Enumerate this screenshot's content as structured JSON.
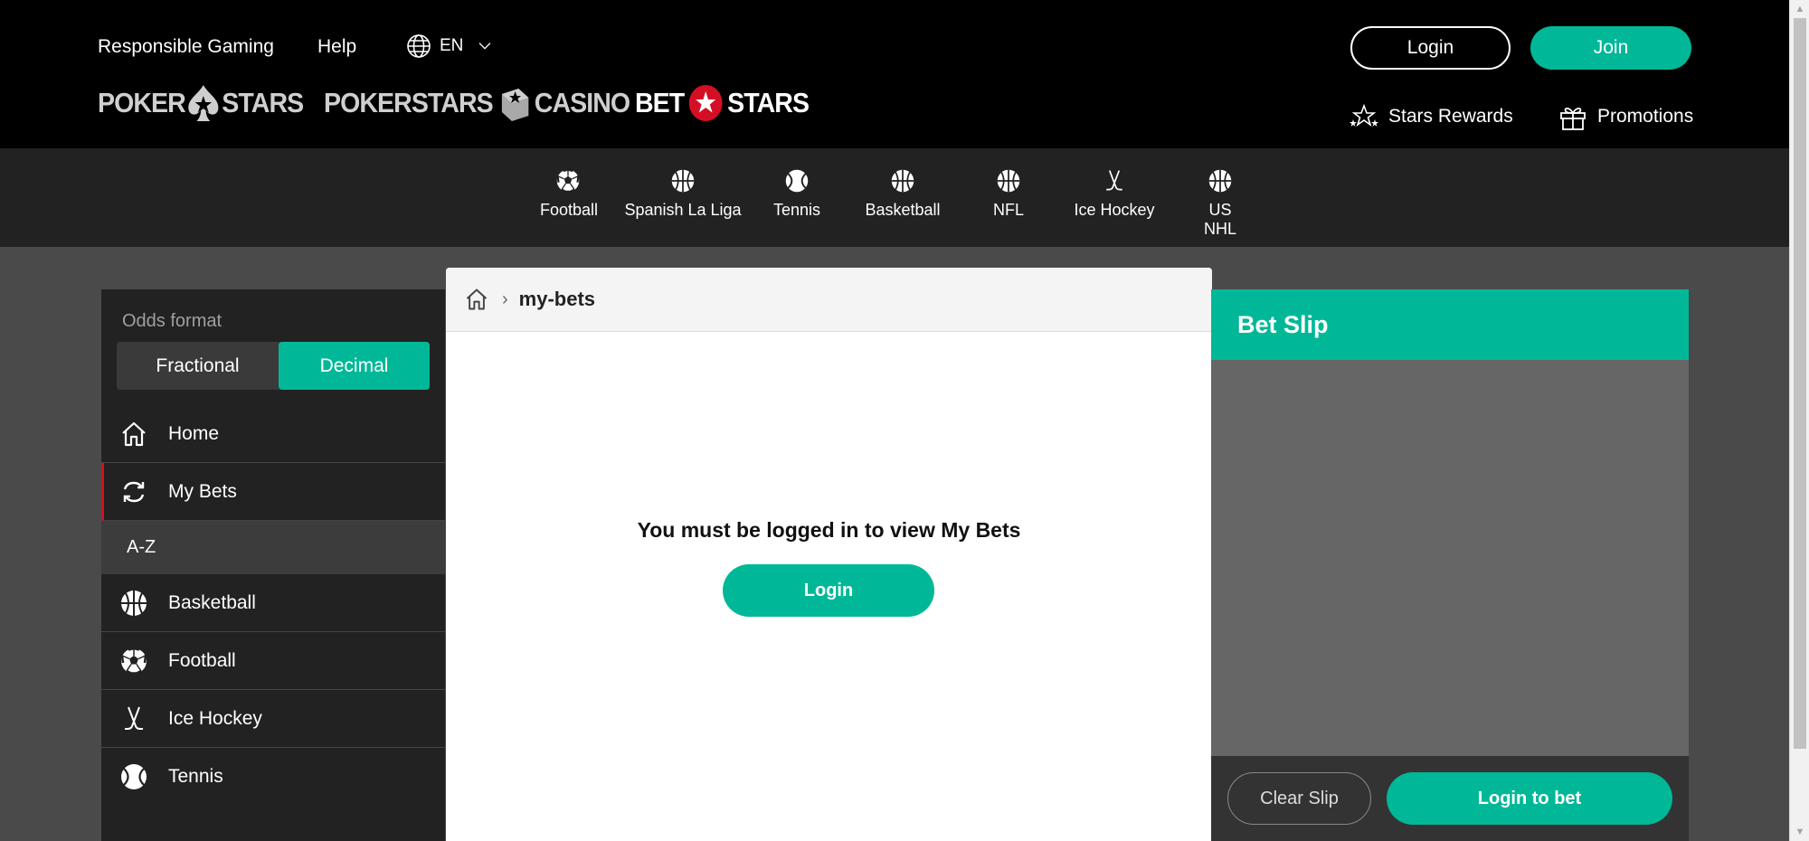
{
  "header": {
    "links": [
      "Responsible Gaming",
      "Help"
    ],
    "language": "EN",
    "login_label": "Login",
    "join_label": "Join",
    "logos": {
      "poker_left": "POKER",
      "poker_right": "STARS",
      "casino_left": "POKERSTARS",
      "casino_right": "CASINO",
      "bet_left": "BET",
      "bet_right": "STARS"
    },
    "stars_rewards": "Stars Rewards",
    "promotions": "Promotions"
  },
  "sports_nav": [
    {
      "label": "Football",
      "icon": "football-icon"
    },
    {
      "label": "Spanish La Liga",
      "icon": "basketball-icon"
    },
    {
      "label": "Tennis",
      "icon": "tennis-icon"
    },
    {
      "label": "Basketball",
      "icon": "basketball-icon"
    },
    {
      "label": "NFL",
      "icon": "basketball-icon"
    },
    {
      "label": "Ice Hockey",
      "icon": "hockey-sticks-icon"
    },
    {
      "label": "US NHL",
      "icon": "basketball-icon"
    }
  ],
  "sidebar": {
    "odds_label": "Odds format",
    "odds_options": [
      "Fractional",
      "Decimal"
    ],
    "odds_selected": "Decimal",
    "menu": [
      {
        "label": "Home",
        "icon": "home-icon"
      },
      {
        "label": "My Bets",
        "icon": "my-bets-icon",
        "active": true
      }
    ],
    "az_label": "A-Z",
    "sports": [
      {
        "label": "Basketball",
        "icon": "basketball-icon"
      },
      {
        "label": "Football",
        "icon": "football-icon"
      },
      {
        "label": "Ice Hockey",
        "icon": "hockey-sticks-icon"
      },
      {
        "label": "Tennis",
        "icon": "tennis-icon"
      }
    ]
  },
  "main": {
    "breadcrumb": "my-bets",
    "message": "You must be logged in to view My Bets",
    "login_label": "Login"
  },
  "betslip": {
    "title": "Bet Slip",
    "clear_label": "Clear Slip",
    "login_label": "Login to bet"
  },
  "colors": {
    "accent": "#00b897",
    "active_marker": "#d40f25",
    "header_bg": "#000000",
    "nav_bg": "#222222"
  }
}
